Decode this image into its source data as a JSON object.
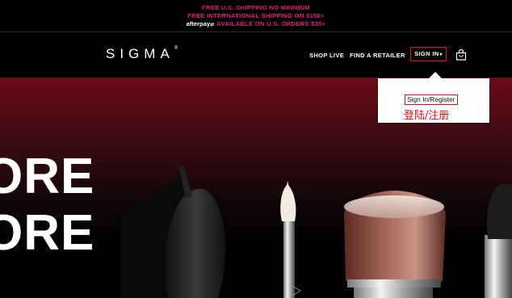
{
  "promo": {
    "line1": "FREE U.S. SHIPPING NO MINIMUM",
    "line2": "FREE INTERNATIONAL SHIPPING ON $150+",
    "afterpay_logo": "afterpay",
    "line3": "AVAILABLE ON U.S. ORDERS $35+"
  },
  "header": {
    "logo": "SIGMA",
    "logo_mark": "®",
    "nav": {
      "shop_live": "SHOP LIVE",
      "find_retailer": "FIND A RETAILER",
      "sign_in": "SIGN IN"
    },
    "cart_icon": "shopping-bag-icon"
  },
  "dropdown": {
    "signin_register": "Sign In/Register",
    "annotation": "登陆/注册"
  },
  "hero": {
    "line1": "ORE",
    "line2": "ORE"
  },
  "colors": {
    "promo_pink": "#e5197f",
    "highlight_red": "#e0121a",
    "hero_red": "#6a0a17"
  }
}
